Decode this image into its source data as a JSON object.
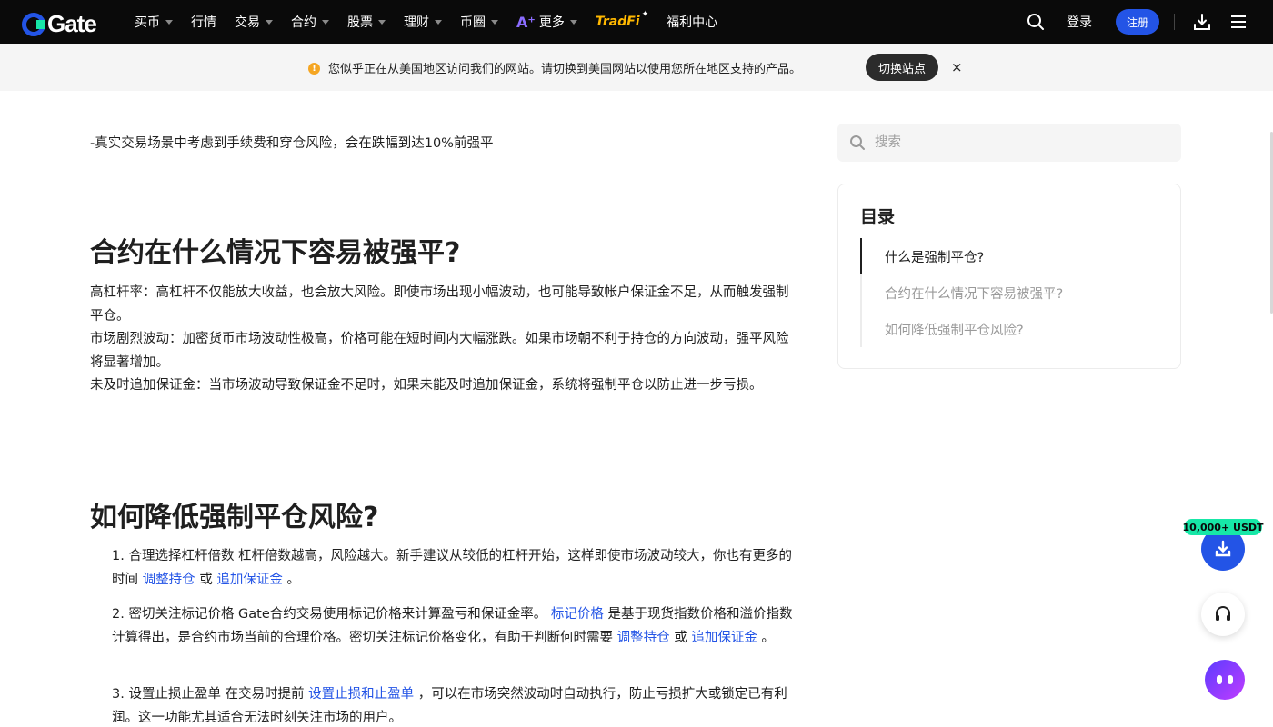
{
  "header": {
    "logo_text": "Gate",
    "nav": [
      {
        "label": "买币",
        "has_caret": true
      },
      {
        "label": "行情",
        "has_caret": false
      },
      {
        "label": "交易",
        "has_caret": true
      },
      {
        "label": "合约",
        "has_caret": true
      },
      {
        "label": "股票",
        "has_caret": true
      },
      {
        "label": "理财",
        "has_caret": true
      },
      {
        "label": "币圈",
        "has_caret": true
      },
      {
        "label": "更多",
        "has_caret": true
      },
      {
        "label": "TradFi",
        "has_caret": false
      },
      {
        "label": "福利中心",
        "has_caret": false
      }
    ],
    "login_label": "登录",
    "signup_label": "注册"
  },
  "notice": {
    "text": "您似乎正在从美国地区访问我们的网站。请切换到美国网站以使用您所在地区支持的产品。",
    "switch_label": "切换站点",
    "close_label": "×"
  },
  "article": {
    "intro_line": "-真实交易场景中考虑到手续费和穿仓风险，会在跌幅到达10%前强平",
    "section1_title": "合约在什么情况下容易被强平?",
    "section1_paras": [
      "高杠杆率：高杠杆不仅能放大收益，也会放大风险。即使市场出现小幅波动，也可能导致帐户保证金不足，从而触发强制平仓。",
      "市场剧烈波动：加密货币市场波动性极高，价格可能在短时间内大幅涨跌。如果市场朝不利于持仓的方向波动，强平风险将显著增加。",
      "未及时追加保证金：当市场波动导致保证金不足时，如果未能及时追加保证金，系统将强制平仓以防止进一步亏损。"
    ],
    "section2_title": "如何降低强制平仓风险?",
    "list": {
      "item1_text": "1. 合理选择杠杆倍数 杠杆倍数越高，风险越大。新手建议从较低的杠杆开始，这样即使市场波动较大，你也有更多的时间 ",
      "item1_link1": "调整持仓",
      "item1_mid": " 或 ",
      "item1_link2": "追加保证金",
      "item1_end": " 。",
      "item2_text": "2. 密切关注标记价格 Gate合约交易使用标记价格来计算盈亏和保证金率。 ",
      "item2_link1": "标记价格",
      "item2_mid": " 是基于现货指数价格和溢价指数计算得出，是合约市场当前的合理价格。密切关注标记价格变化，有助于判断何时需要 ",
      "item2_link2": "调整持仓",
      "item2_mid2": " 或 ",
      "item2_link3": "追加保证金",
      "item2_end": " 。",
      "item3_text": "3. 设置止损止盈单 在交易时提前 ",
      "item3_link": "设置止损和止盈单",
      "item3_end": " ，可以在市场突然波动时自动执行，防止亏损扩大或锁定已有利润。这一功能尤其适合无法时刻关注市场的用户。"
    }
  },
  "sidebar": {
    "search_placeholder": "搜索",
    "toc_title": "目录",
    "toc_items": [
      {
        "label": "什么是强制平仓?",
        "active": true
      },
      {
        "label": "合约在什么情况下容易被强平?",
        "active": false
      },
      {
        "label": "如何降低强制平仓风险?",
        "active": false
      }
    ]
  },
  "floating": {
    "promo_label": "10,000+ USDT"
  },
  "colors": {
    "brand_blue": "#2354e6",
    "brand_green": "#17e7a7",
    "header_bg": "#0a0a0a",
    "link": "#2354e6",
    "warning": "#f5a623"
  },
  "icons": [
    "search-icon",
    "download-icon",
    "menu-icon",
    "warning-icon",
    "close-icon",
    "headset-icon",
    "chatbot-icon",
    "caret-down-icon"
  ]
}
